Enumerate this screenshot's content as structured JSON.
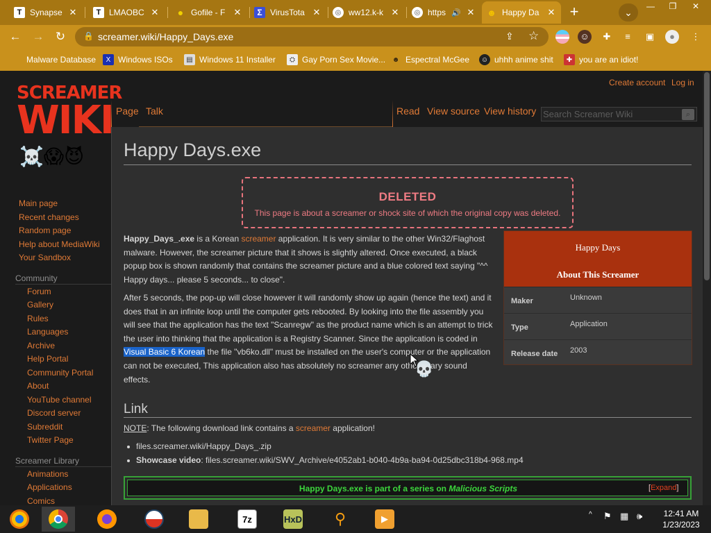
{
  "browser": {
    "tabs": [
      {
        "title": "Synapse",
        "icon": "t-icon"
      },
      {
        "title": "LMAOBC",
        "icon": "t-icon"
      },
      {
        "title": "Gofile - F",
        "icon": "lemon-icon"
      },
      {
        "title": "VirusTota",
        "icon": "virustotal-icon"
      },
      {
        "title": "ww12.k-k",
        "icon": "globe-icon"
      },
      {
        "title": "https",
        "icon": "globe-icon"
      },
      {
        "title": "Happy Da",
        "icon": "screamer-icon"
      }
    ],
    "url": "screamer.wiki/Happy_Days.exe",
    "bookmarks": [
      {
        "label": "Malware Database"
      },
      {
        "label": "Windows ISOs"
      },
      {
        "label": "Windows 11 Installer"
      },
      {
        "label": "Gay Porn Sex Movie..."
      },
      {
        "label": "Espectral McGee"
      },
      {
        "label": "uhhh anime shit"
      },
      {
        "label": "you are an idiot!"
      }
    ]
  },
  "wiki": {
    "logo_line1": "SCREAMER",
    "logo_line2": "WIKI",
    "create_account": "Create account",
    "log_in": "Log in",
    "sidebar_main": [
      "Main page",
      "Recent changes",
      "Random page",
      "Help about MediaWiki",
      "Your Sandbox"
    ],
    "community_heading": "Community",
    "community": [
      "Forum",
      "Gallery",
      "Rules",
      "Languages",
      "Archive",
      "Help Portal",
      "Community Portal",
      "About",
      "YouTube channel",
      "Discord server",
      "Subreddit",
      "Twitter Page"
    ],
    "library_heading": "Screamer Library",
    "library": [
      "Animations",
      "Applications",
      "Comics"
    ],
    "tabs": {
      "page": "Page",
      "talk": "Talk",
      "read": "Read",
      "view_source": "View source",
      "view_history": "View history"
    },
    "search_placeholder": "Search Screamer Wiki",
    "title": "Happy Days.exe",
    "notice": {
      "title": "DELETED",
      "text": "This page is about a screamer or shock site of which the original copy was deleted."
    },
    "para1": {
      "bold": "Happy_Days_.exe",
      "t1": " is a Korean ",
      "link": "screamer",
      "t2": " application. It is very similar to the other Win32/Flaghost malware. However, the screamer picture that it shows is slightly altered. Once executed, a black popup box is shown randomly that contains the screamer picture and a blue colored text saying \"^^ Happy days... please 5 seconds... to close\"."
    },
    "para2": {
      "t1": "After 5 seconds, the pop-up will close however it will randomly show up again (hence the text) and it does that in an infinite loop until the computer gets rebooted. By looking into the file assembly you will see that the application has the text \"Scanregw\" as the product name which is an attempt to trick the user into thinking that the application is a Registry Scanner. Since the application is coded in ",
      "highlight": "Visual Basic 6 Korean",
      "t2": " the file \"vb6ko.dll\" must be installed on the user's computer or the application can not be executed, This application also has absolutely no screamer any other scary sound effects."
    },
    "infobox": {
      "name": "Happy Days",
      "about": "About This Screamer",
      "rows": [
        {
          "key": "Maker",
          "value": "Unknown"
        },
        {
          "key": "Type",
          "value": "Application"
        },
        {
          "key": "Release date",
          "value": "2003"
        }
      ]
    },
    "link_heading": "Link",
    "note_label": "NOTE",
    "note_text": ": The following download link contains a ",
    "note_link": "screamer",
    "note_end": " application!",
    "bullets": {
      "download": "files.screamer.wiki/Happy_Days_.zip",
      "showcase_label": "Showcase video",
      "showcase_url": ": files.screamer.wiki/SWV_Archive/e4052ab1-b040-4b9a-ba94-0d25dbc318b4-968.mp4"
    },
    "navbox": {
      "prefix": "Happy Days.exe is part of a series on ",
      "series": "Malicious Scripts",
      "expand": "Expand"
    }
  },
  "taskbar": {
    "apps": [
      "chrome-canary-icon",
      "chrome-icon",
      "firefox-icon",
      "obama-icon",
      "file-explorer-icon",
      "7zip-icon",
      "hxd-icon",
      "search-icon",
      "media-player-icon"
    ],
    "time": "12:41 AM",
    "date": "1/23/2023"
  }
}
